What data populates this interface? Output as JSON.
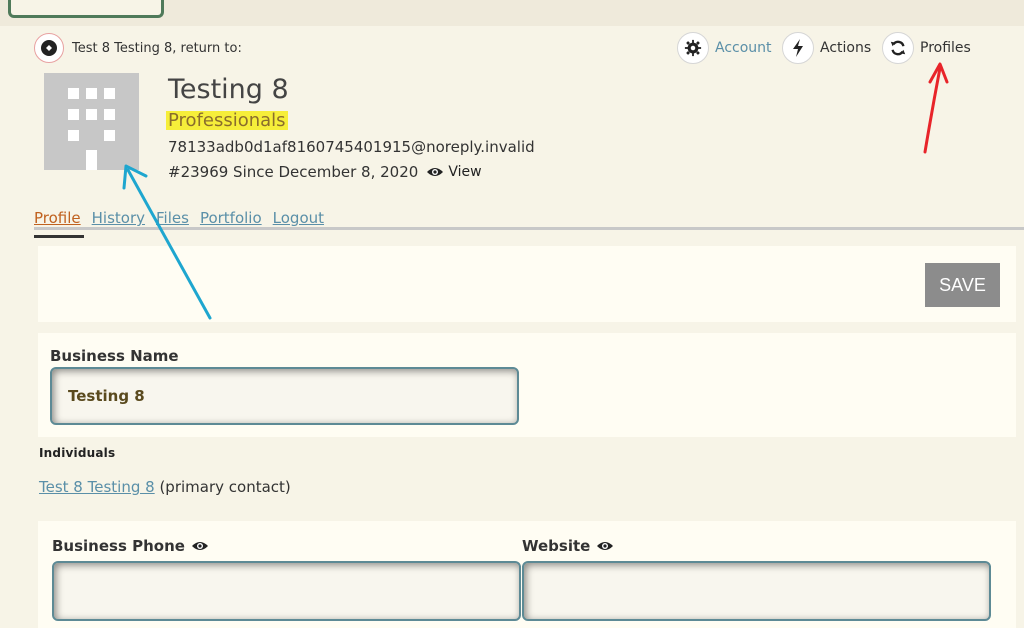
{
  "header": {
    "return_text": "Test 8 Testing 8, return to:",
    "nav": {
      "account": "Account",
      "actions": "Actions",
      "profiles": "Profiles"
    }
  },
  "profile": {
    "name": "Testing 8",
    "type": "Professionals",
    "email": "78133adb0d1af8160745401915@noreply.invalid",
    "since": "#23969 Since December 8, 2020",
    "view_label": "View"
  },
  "tabs": [
    {
      "label": "Profile",
      "active": true
    },
    {
      "label": "History",
      "active": false
    },
    {
      "label": "Files",
      "active": false
    },
    {
      "label": "Portfolio",
      "active": false
    },
    {
      "label": "Logout",
      "active": false
    }
  ],
  "save_label": "SAVE",
  "form": {
    "business_name_label": "Business Name",
    "business_name_value": "Testing 8",
    "individuals_heading": "Individuals",
    "primary_contact_link": "Test 8 Testing 8",
    "primary_contact_suffix": "(primary contact)",
    "business_phone_label": "Business Phone",
    "business_phone_value": "",
    "website_label": "Website",
    "website_value": ""
  },
  "colors": {
    "link": "#5a8fa8",
    "active_tab": "#c0611f",
    "highlight": "#f6ee3a",
    "annotation_red": "#e8242a",
    "annotation_blue": "#1ea6cf"
  }
}
